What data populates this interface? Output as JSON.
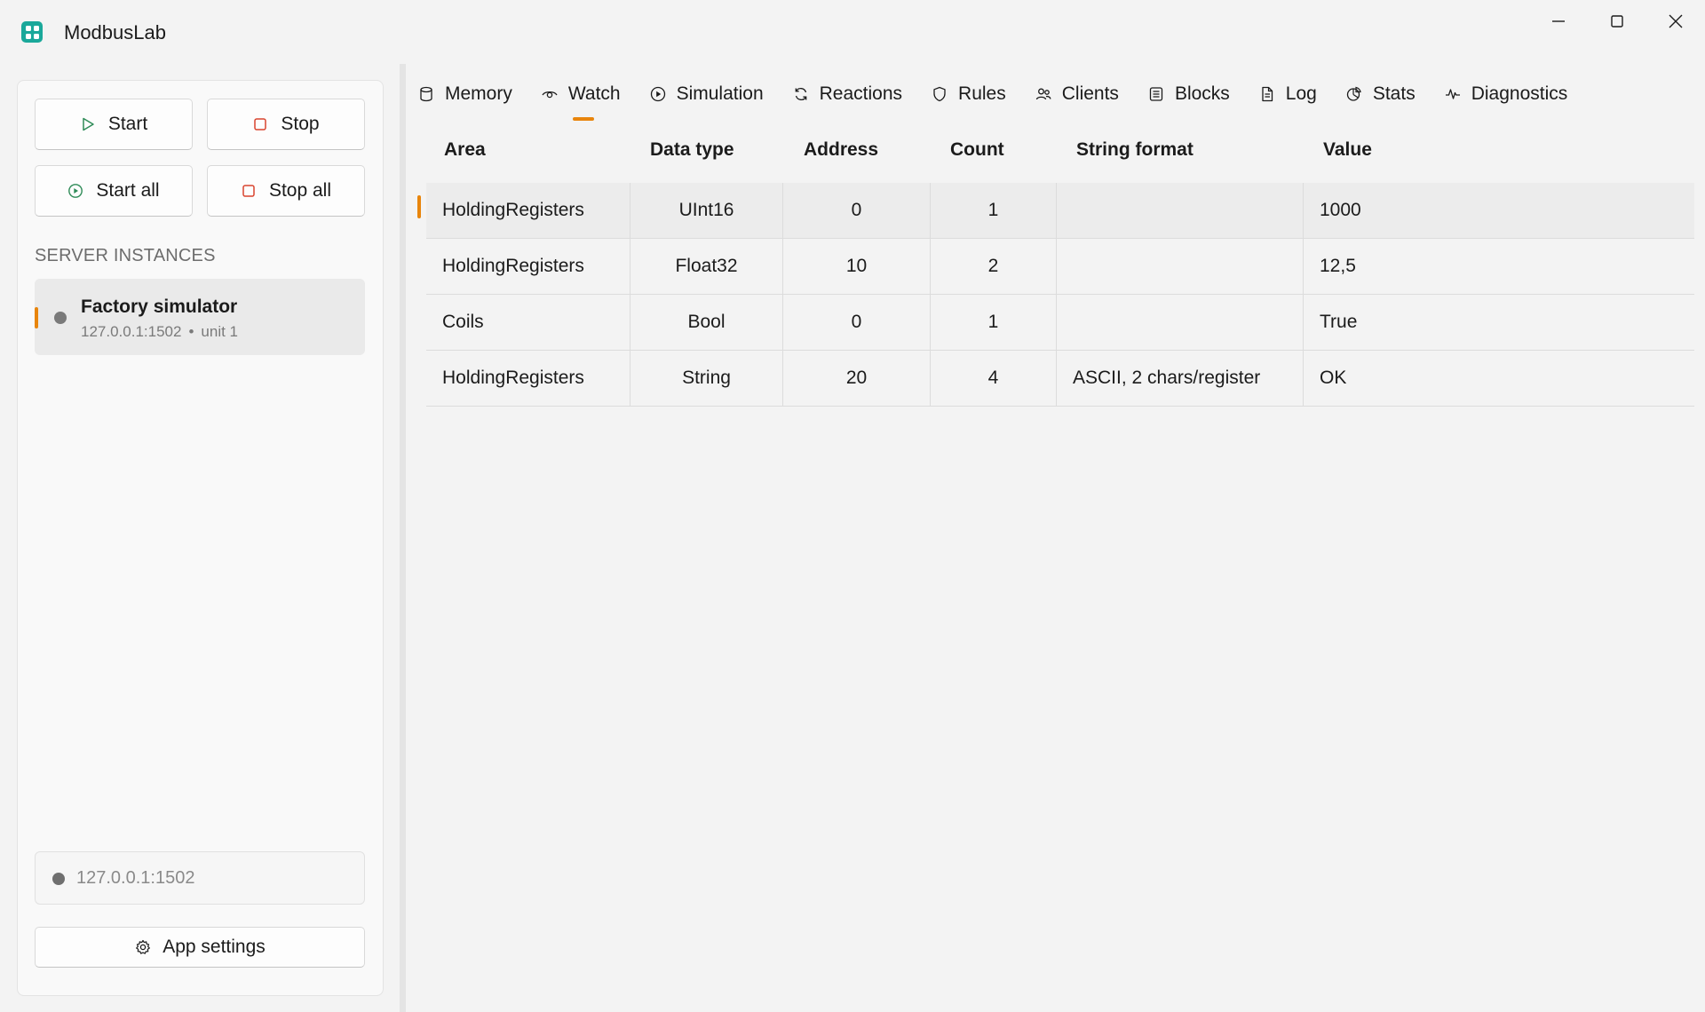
{
  "app": {
    "title": "ModbusLab"
  },
  "sidebar": {
    "start_label": "Start",
    "stop_label": "Stop",
    "start_all_label": "Start all",
    "stop_all_label": "Stop all",
    "section_label": "SERVER INSTANCES",
    "servers": [
      {
        "name": "Factory simulator",
        "address": "127.0.0.1:1502",
        "separator": "•",
        "unit": "unit 1"
      }
    ],
    "endpoint": "127.0.0.1:1502",
    "settings_label": "App settings"
  },
  "tabs": [
    {
      "label": "Memory",
      "icon": "database-icon"
    },
    {
      "label": "Watch",
      "icon": "eye-icon",
      "active": true
    },
    {
      "label": "Simulation",
      "icon": "play-circle-icon"
    },
    {
      "label": "Reactions",
      "icon": "refresh-icon"
    },
    {
      "label": "Rules",
      "icon": "shield-icon"
    },
    {
      "label": "Clients",
      "icon": "people-icon"
    },
    {
      "label": "Blocks",
      "icon": "list-icon"
    },
    {
      "label": "Log",
      "icon": "document-icon"
    },
    {
      "label": "Stats",
      "icon": "chart-icon"
    },
    {
      "label": "Diagnostics",
      "icon": "pulse-icon"
    }
  ],
  "table": {
    "headers": {
      "area": "Area",
      "data_type": "Data type",
      "address": "Address",
      "count": "Count",
      "string_format": "String format",
      "value": "Value"
    },
    "rows": [
      {
        "area": "HoldingRegisters",
        "data_type": "UInt16",
        "address": "0",
        "count": "1",
        "string_format": "",
        "value": "1000"
      },
      {
        "area": "HoldingRegisters",
        "data_type": "Float32",
        "address": "10",
        "count": "2",
        "string_format": "",
        "value": "12,5"
      },
      {
        "area": "Coils",
        "data_type": "Bool",
        "address": "0",
        "count": "1",
        "string_format": "",
        "value": "True"
      },
      {
        "area": "HoldingRegisters",
        "data_type": "String",
        "address": "20",
        "count": "4",
        "string_format": "ASCII, 2 chars/register",
        "value": "OK"
      }
    ]
  },
  "colors": {
    "accent": "#e8850c",
    "brand": "#1aa89a",
    "start_green": "#2e8b57",
    "stop_red": "#d9452f"
  }
}
